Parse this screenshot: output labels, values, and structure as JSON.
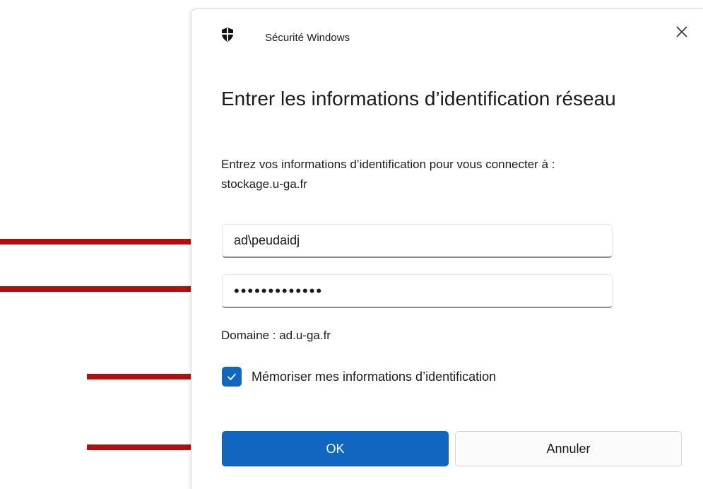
{
  "dialog": {
    "app_title": "Sécurité Windows",
    "heading": "Entrer les informations d’identification réseau",
    "description_line1": "Entrez vos informations d’identification pour vous connecter à :",
    "description_line2": "stockage.u-ga.fr",
    "username_value": "ad\\peudaidj",
    "password_masked": "•••••••••••••",
    "domain": "Domaine : ad.u-ga.fr",
    "remember": {
      "label": "Mémoriser mes informations d’identification",
      "checked": true
    },
    "ok_label": "OK",
    "cancel_label": "Annuler"
  },
  "colors": {
    "accent": "#1166c0",
    "arrow": "#b30f0f"
  },
  "icons": [
    "shield-icon",
    "close-icon",
    "checkmark-icon"
  ]
}
